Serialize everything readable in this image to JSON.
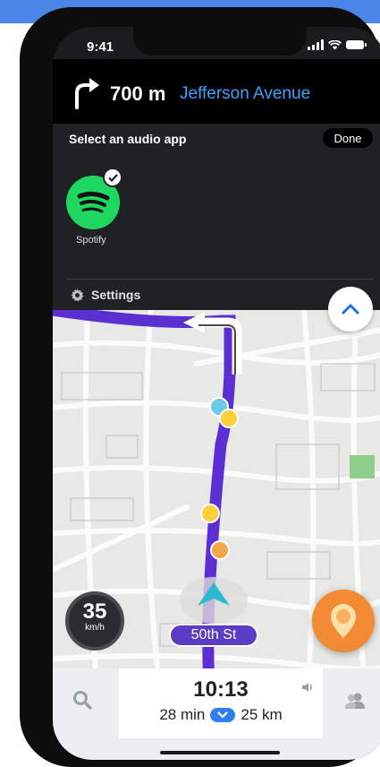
{
  "status_bar": {
    "time": "9:41"
  },
  "navigation": {
    "distance": "700 m",
    "street": "Jefferson Avenue"
  },
  "audio_panel": {
    "title": "Select an audio app",
    "done_label": "Done",
    "apps": [
      {
        "name": "Spotify",
        "selected": true
      }
    ],
    "settings_label": "Settings"
  },
  "map": {
    "speed": {
      "value": "35",
      "unit": "km/h"
    },
    "current_street": "50th St"
  },
  "trip": {
    "arrival_time": "10:13",
    "duration": "28 min",
    "distance": "25 km"
  },
  "colors": {
    "route": "#5b2fd1",
    "spotify": "#1ed760",
    "accent": "#3ea0ff",
    "action": "#f08b34"
  }
}
